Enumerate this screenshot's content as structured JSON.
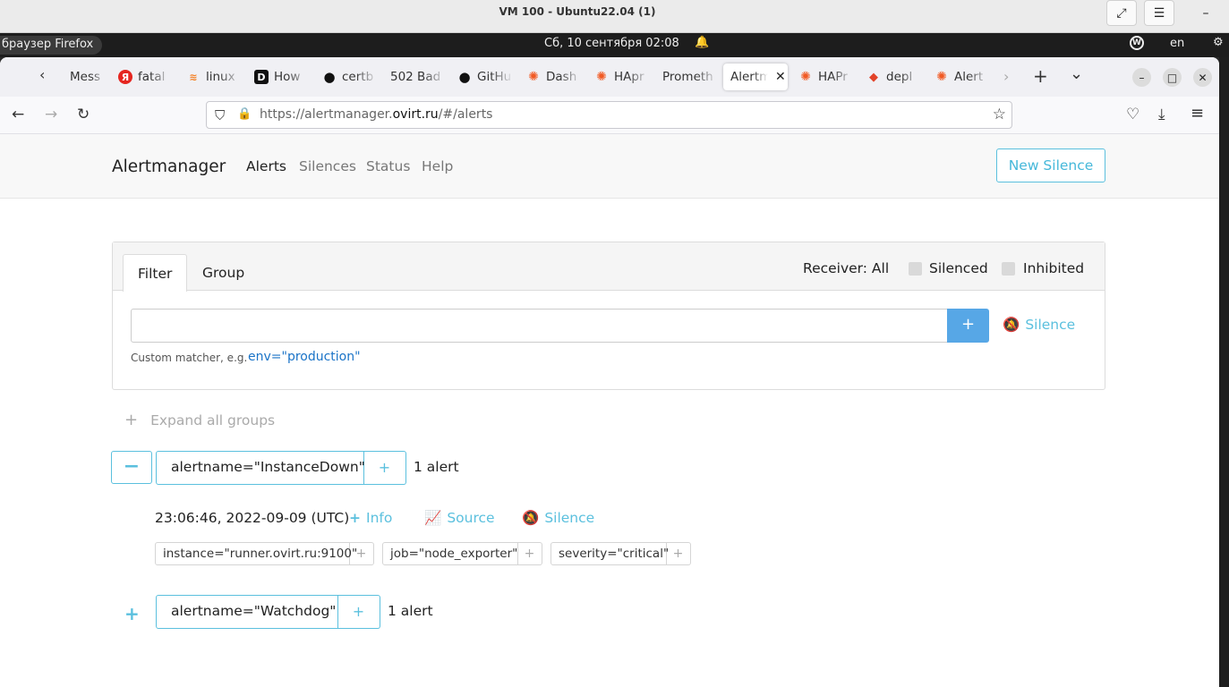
{
  "vm": {
    "title": "VM 100 - Ubuntu22.04 (1)",
    "expand_icon": "⤢",
    "menu_icon": "☰",
    "minimize_icon": "–"
  },
  "panel": {
    "app_name": "браузер Firefox",
    "clock": "Сб, 10 сентября  02:08",
    "bell_icon": "🔔",
    "tray_w": "W",
    "lang": "en",
    "net_icon": "⚙"
  },
  "firefox": {
    "tabs": [
      {
        "label": "Mess",
        "icon": ""
      },
      {
        "label": "fatal",
        "icon": "Я"
      },
      {
        "label": "linux",
        "icon": "≋"
      },
      {
        "label": "How",
        "icon": "D"
      },
      {
        "label": "certb",
        "icon": "●"
      },
      {
        "label": "502 Bad",
        "icon": ""
      },
      {
        "label": "GitHu",
        "icon": "●"
      },
      {
        "label": "Dash",
        "icon": "✺"
      },
      {
        "label": "HApr",
        "icon": "✺"
      },
      {
        "label": "Prometh",
        "icon": ""
      },
      {
        "label": "Alertm",
        "icon": "",
        "close": "✕"
      },
      {
        "label": "HAPr",
        "icon": "✺"
      },
      {
        "label": "depl",
        "icon": "◆"
      },
      {
        "label": "Alert",
        "icon": "✺"
      }
    ],
    "tab_scroll_left": "‹",
    "tab_scroll_right": "›",
    "new_tab": "+",
    "tab_list": "⌄",
    "win_min": "–",
    "win_max": "□",
    "win_close": "✕",
    "back_icon": "←",
    "forward_icon": "→",
    "reload_icon": "↻",
    "url_shield": "⛉",
    "url_lock": "🔒",
    "url_prefix": "https://alertmanager.",
    "url_domain": "ovirt.ru",
    "url_suffix": "/#/alerts",
    "star_icon": "☆",
    "pocket_icon": "♡",
    "download_icon": "⤓",
    "menu_icon": "≡"
  },
  "am": {
    "brand": "Alertmanager",
    "nav": [
      "Alerts",
      "Silences",
      "Status",
      "Help"
    ],
    "new_silence": "New Silence",
    "filter_tab": "Filter",
    "group_tab": "Group",
    "receiver": "Receiver: All",
    "silenced": "Silenced",
    "inhibited": "Inhibited",
    "filter_value": "",
    "add_plus": "+",
    "silence_btn": "Silence",
    "silence_icon": "🔕",
    "hint": "Custom matcher, e.g.",
    "hint_example": "env=\"production\"",
    "expand_all_plus": "+",
    "expand_all": "Expand all groups",
    "groups": [
      {
        "toggle": "−",
        "label": "alertname=\"InstanceDown\"",
        "plus": "+",
        "count": "1 alert",
        "alert": {
          "time": "23:06:46, 2022-09-09 (UTC)",
          "info_icon": "+",
          "info": "Info",
          "source_icon": "📈",
          "source": "Source",
          "silence_icon": "🔕",
          "silence": "Silence",
          "labels": [
            {
              "text": "instance=\"runner.ovirt.ru:9100\"",
              "plus": "+"
            },
            {
              "text": "job=\"node_exporter\"",
              "plus": "+"
            },
            {
              "text": "severity=\"critical\"",
              "plus": "+"
            }
          ]
        }
      },
      {
        "toggle": "+",
        "label": "alertname=\"Watchdog\"",
        "plus": "+",
        "count": "1 alert"
      }
    ]
  }
}
